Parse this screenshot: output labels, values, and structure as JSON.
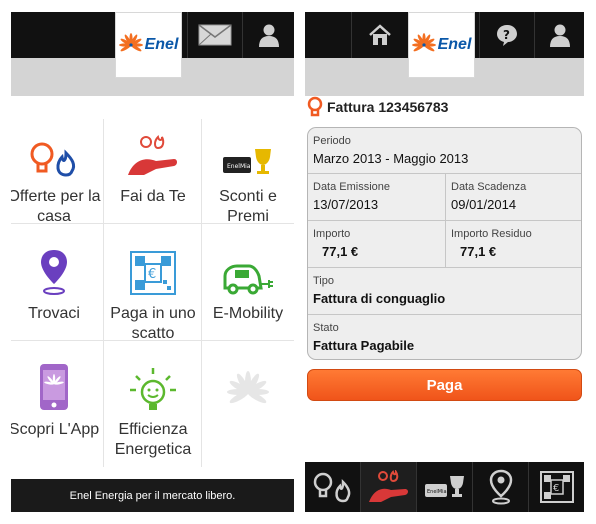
{
  "left": {
    "header": {
      "logo_text": "Enel"
    },
    "tiles": [
      {
        "label": "Offerte per la casa",
        "label_l1": "Offerte per la",
        "label_l2": "casa",
        "icon": "bulb-flame-icon"
      },
      {
        "label": "Fai da Te",
        "label_l1": "Fai da Te",
        "label_l2": "",
        "icon": "hand-bulb-icon"
      },
      {
        "label": "Sconti e Premi",
        "label_l1": "Sconti e",
        "label_l2": "Premi",
        "icon": "card-trophy-icon"
      },
      {
        "label": "Trovaci",
        "label_l1": "Trovaci",
        "label_l2": "",
        "icon": "map-pin-icon"
      },
      {
        "label": "Paga in uno scatto",
        "label_l1": "Paga in uno",
        "label_l2": "scatto",
        "icon": "qr-euro-icon"
      },
      {
        "label": "E-Mobility",
        "label_l1": "E-Mobility",
        "label_l2": "",
        "icon": "electric-car-icon"
      },
      {
        "label": "Scopri L'App",
        "label_l1": "Scopri L'App",
        "label_l2": "",
        "icon": "phone-icon"
      },
      {
        "label": "Efficienza Energetica",
        "label_l1": "Efficienza",
        "label_l2": "Energetica",
        "icon": "smiley-bulb-icon"
      },
      {
        "label": "",
        "label_l1": "",
        "label_l2": "",
        "icon": "enel-flower-faded-icon"
      }
    ],
    "footer": "Enel Energia per il mercato libero."
  },
  "right": {
    "header": {
      "logo_text": "Enel"
    },
    "title": "Fattura 123456783",
    "periodo": {
      "label": "Periodo",
      "value": "Marzo 2013 - Maggio 2013"
    },
    "data_emissione": {
      "label": "Data Emissione",
      "value": "13/07/2013"
    },
    "data_scadenza": {
      "label": "Data Scadenza",
      "value": "09/01/2014"
    },
    "importo": {
      "label": "Importo",
      "value": "77,1 €"
    },
    "importo_residuo": {
      "label": "Importo Residuo",
      "value": "77,1 €"
    },
    "tipo": {
      "label": "Tipo",
      "value": "Fattura di conguaglio"
    },
    "stato": {
      "label": "Stato",
      "value": "Fattura Pagabile"
    },
    "pay_button": "Paga"
  },
  "colors": {
    "accent": "#f0541a",
    "enel_blue": "#0a57a8",
    "topbar": "#111111"
  }
}
